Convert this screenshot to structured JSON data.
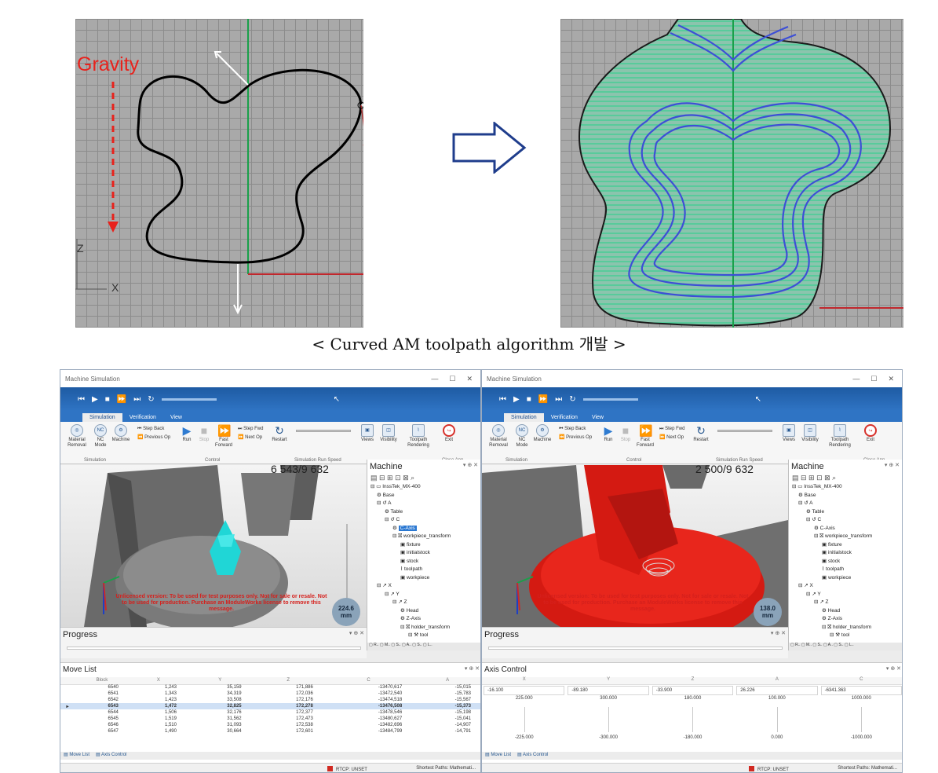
{
  "figure": {
    "gravity_label": "Gravity",
    "axis_z": "Z",
    "axis_x": "X",
    "caption": "< Curved AM toolpath algorithm 개발 >"
  },
  "windows": [
    {
      "title": "Machine Simulation",
      "tabs": [
        "Simulation",
        "Verification",
        "View"
      ],
      "ribbon": {
        "material_removal": "Material Removal",
        "nc_mode": "NC Mode",
        "machine": "Machine",
        "step_back": "Step Back",
        "previous_op": "Previous Op",
        "run": "Run",
        "stop": "Stop",
        "fast_forward": "Fast Forward",
        "step_fwd": "Step Fwd",
        "next_op": "Next Op",
        "restart": "Restart",
        "views": "Views",
        "visibility": "Visibility",
        "toolpath_rendering": "Toolpath Rendering",
        "exit": "Exit",
        "group_simulation": "Simulation",
        "group_control": "Control",
        "group_speed": "Simulation Run Speed",
        "group_close": "Close App"
      },
      "block_count": "6 543/9 632",
      "distance": "224.6\nmm",
      "watermark": "Unlicensed version: To be used for test purposes only. Not for sale or resale. Not to be used for production. Purchase an ModuleWorks license to remove this message.",
      "machine_panel": {
        "title": "Machine",
        "tree": [
          "InssTek_MX-400",
          "Base",
          "A",
          "Table",
          "C",
          "C-Axis",
          "workpiece_transform",
          "fixture",
          "initialstock",
          "stock",
          "toolpath",
          "workpiece",
          "X",
          "Y",
          "Z",
          "Head",
          "Z-Axis",
          "holder_transform",
          "tool"
        ]
      },
      "progress_title": "Progress",
      "bottom_title": "Move List",
      "movelist": {
        "columns": [
          "Block",
          "X",
          "Y",
          "Z",
          "C",
          "A"
        ],
        "rows": [
          [
            "6540",
            "1,243",
            "35,159",
            "171,886",
            "-13470,617",
            "-15,015"
          ],
          [
            "6541",
            "1,343",
            "34,319",
            "172,036",
            "-13472,540",
            "-15,783"
          ],
          [
            "6542",
            "1,423",
            "33,508",
            "172,176",
            "-13474,518",
            "-15,567"
          ],
          [
            "6543",
            "1,472",
            "32,825",
            "172,278",
            "-13476,508",
            "-15,373"
          ],
          [
            "6544",
            "1,506",
            "32,176",
            "172,377",
            "-13478,546",
            "-15,198"
          ],
          [
            "6545",
            "1,519",
            "31,562",
            "172,473",
            "-13480,627",
            "-15,041"
          ],
          [
            "6546",
            "1,510",
            "31,093",
            "172,538",
            "-13482,696",
            "-14,907"
          ],
          [
            "6547",
            "1,490",
            "30,664",
            "172,601",
            "-13484,799",
            "-14,791"
          ]
        ]
      },
      "bottom_tabs": [
        "Move List",
        "Axis Control"
      ],
      "status_rtcp": "RTCP: UNSET",
      "status_paths": "Shortest Paths: Mathemati..."
    },
    {
      "title": "Machine Simulation",
      "tabs": [
        "Simulation",
        "Verification",
        "View"
      ],
      "block_count": "2 500/9 632",
      "distance": "138.0\nmm",
      "watermark": "Unlicensed version: To be used for test purposes only. Not for sale or resale. Not to be used for production. Purchase an ModuleWorks license to remove this message.",
      "machine_panel": {
        "title": "Machine",
        "tree": [
          "InssTek_MX-400",
          "Base",
          "A",
          "Table",
          "C",
          "C-Axis",
          "workpiece_transform",
          "fixture",
          "initialstock",
          "stock",
          "toolpath",
          "workpiece",
          "X",
          "Y",
          "Z",
          "Head",
          "Z-Axis",
          "holder_transform",
          "tool"
        ]
      },
      "progress_title": "Progress",
      "bottom_title": "Axis Control",
      "axis_control": {
        "columns": [
          "X",
          "Y",
          "Z",
          "A",
          "C"
        ],
        "values": [
          "-16.100",
          "-89.180",
          "-33.900",
          "26.226",
          "-6341.363"
        ],
        "max": [
          "225.000",
          "300.000",
          "180.000",
          "100.000",
          "1000.000"
        ],
        "min": [
          "-225.000",
          "-300.000",
          "-180.000",
          "0.000",
          "-1000.000"
        ]
      },
      "bottom_tabs": [
        "Move List",
        "Axis Control"
      ],
      "status_rtcp": "RTCP: UNSET",
      "status_paths": "Shortest Paths: Mathemati..."
    }
  ]
}
